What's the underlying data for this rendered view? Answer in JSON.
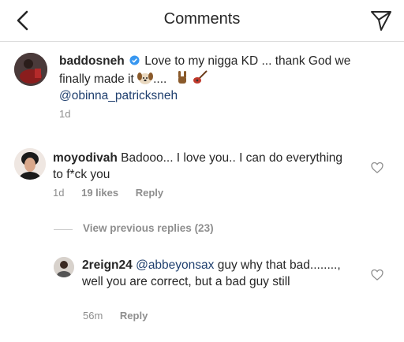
{
  "header": {
    "title": "Comments",
    "back_icon": "chevron-left-icon",
    "send_icon": "paper-plane-icon"
  },
  "caption": {
    "username": "baddosneh",
    "text_part1": "Love to my nigga KD ... thank God we finally made it",
    "text_part2": "....",
    "mention": "@obinna_patricksneh",
    "time": "1d",
    "emojis": [
      "dog-face-icon",
      "rock-hand-icon",
      "guitar-icon"
    ]
  },
  "comments": [
    {
      "username": "moyodivah",
      "text": "Badooo... I love you.. I can do everything to f*ck you",
      "time": "1d",
      "likes": "19 likes",
      "reply": "Reply"
    }
  ],
  "view_replies": "View previous replies (23)",
  "replies": [
    {
      "username": "2reign24",
      "mention": "@abbeyonsax",
      "text": "guy why that bad........, well you are correct,  but a bad guy still",
      "time": "56m",
      "reply": "Reply"
    }
  ],
  "colors": {
    "text": "#262626",
    "meta": "#8e8e8e",
    "verified": "#3897f0",
    "mention": "#1f3f6e"
  }
}
